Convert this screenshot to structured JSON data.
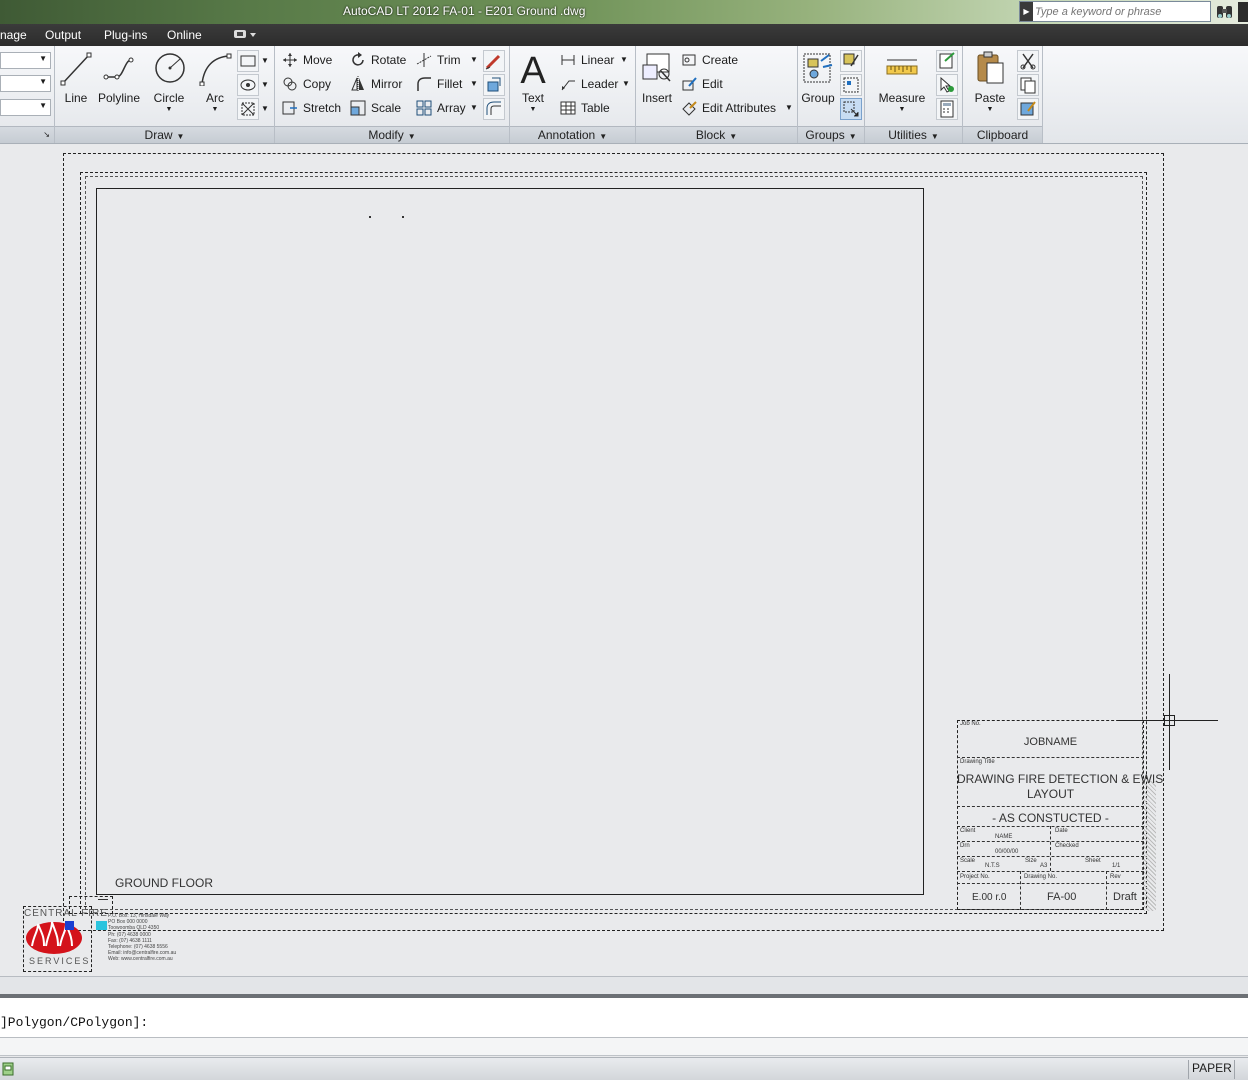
{
  "window": {
    "title": "AutoCAD LT 2012    FA-01 - E201 Ground .dwg"
  },
  "search": {
    "placeholder": "Type a keyword or phrase"
  },
  "menu_tabs": [
    "nage",
    "Output",
    "Plug-ins",
    "Online"
  ],
  "ribbon": {
    "draw": {
      "line": "Line",
      "polyline": "Polyline",
      "circle": "Circle",
      "arc": "Arc",
      "panel": "Draw"
    },
    "modify": {
      "move": "Move",
      "rotate": "Rotate",
      "trim": "Trim",
      "copy": "Copy",
      "mirror": "Mirror",
      "fillet": "Fillet",
      "stretch": "Stretch",
      "scale": "Scale",
      "array": "Array",
      "panel": "Modify"
    },
    "annotation": {
      "text": "Text",
      "linear": "Linear",
      "leader": "Leader",
      "table": "Table",
      "panel": "Annotation"
    },
    "block": {
      "insert": "Insert",
      "create": "Create",
      "edit": "Edit",
      "edit_attributes": "Edit Attributes",
      "panel": "Block"
    },
    "groups": {
      "group": "Group",
      "panel": "Groups"
    },
    "utilities": {
      "measure": "Measure",
      "panel": "Utilities"
    },
    "clipboard": {
      "paste": "Paste",
      "panel": "Clipboard"
    }
  },
  "drawing": {
    "floor_label": "GROUND FLOOR",
    "titleblock": {
      "jobname": "JOBNAME",
      "drawing_title_1": "DRAWING FIRE DETECTION & EWIS",
      "drawing_title_2": "LAYOUT",
      "status": "- AS CONSTUCTED -",
      "project_no": "E.00 r.0",
      "drawing_no": "FA-00",
      "revision": "Draft"
    },
    "logo": {
      "top_text": "CENTRAL FIRE",
      "bottom_text": "SERVICES"
    },
    "contact_lines": [
      "P.O. Box: 13, Hinsdale Way",
      "PO Box 000 0000",
      "Toowoomba QLD 4350",
      "Ph: (07) 4638 0000",
      "Fax: (07) 4638 1111",
      "Telephone: (07) 4638 5556",
      "Email: info@centralfire.com.au",
      "Web: www.centralfire.com.au"
    ]
  },
  "command": {
    "history": "]Polygon/CPolygon]:"
  },
  "status": {
    "layout_mode": "PAPER"
  },
  "colors": {
    "titlebar": "#587a48",
    "tabs": "#2f2f2f",
    "canvas": "#e9eaec",
    "logo_red": "#d4131b"
  }
}
